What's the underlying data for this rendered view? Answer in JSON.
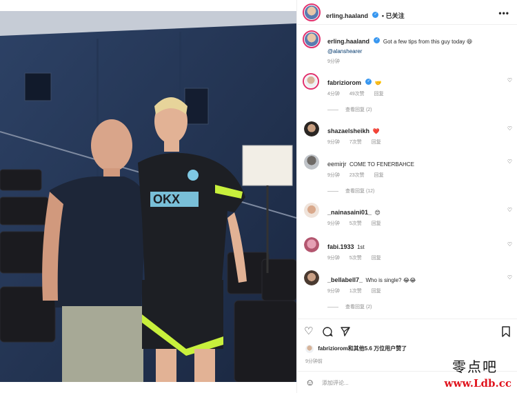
{
  "header": {
    "username": "erling.haaland",
    "follow_status": "• 已关注",
    "more": "•••"
  },
  "caption": {
    "username": "erling.haaland",
    "text": "Got a few tips from this guy today 😄",
    "mention": "@alanshearer",
    "time": "9分钟"
  },
  "comments": [
    {
      "username": "fabriziorom",
      "verified": true,
      "text": "🤝",
      "time": "4分钟",
      "likes": "49次赞",
      "reply": "回复",
      "replies": "查看回复 (2)"
    },
    {
      "username": "shazaelsheikh",
      "verified": false,
      "text": "❤️",
      "time": "9分钟",
      "likes": "7次赞",
      "reply": "回复",
      "replies": ""
    },
    {
      "username": "eemirjr",
      "verified": false,
      "text": "COME TO FENERBAHCE",
      "time": "9分钟",
      "likes": "23次赞",
      "reply": "回复",
      "replies": "查看回复 (12)"
    },
    {
      "username": "_nainasaini01_",
      "verified": false,
      "text": "😍",
      "time": "9分钟",
      "likes": "5次赞",
      "reply": "回复",
      "replies": ""
    },
    {
      "username": "fabi.1933",
      "verified": false,
      "text": "1st",
      "time": "9分钟",
      "likes": "5次赞",
      "reply": "回复",
      "replies": ""
    },
    {
      "username": "_bellabell7_",
      "verified": false,
      "text": "Who is single? 😂😂",
      "time": "9分钟",
      "likes": "1次赞",
      "reply": "回复",
      "replies": "查看回复 (2)"
    }
  ],
  "likes_line": {
    "user": "fabriziorom",
    "rest": "和其他5.6 万位用户赞了"
  },
  "post_time": "9分钟前",
  "comment_input": {
    "placeholder": "添加评论..."
  },
  "watermark": {
    "cn": "零点吧",
    "url": "www.Ldb.cc"
  },
  "colors": {
    "verified": "#3897f0",
    "story_ring": "#e1306c",
    "jersey_accent": "#7ec8e3",
    "kit_neon": "#c8f03c"
  }
}
